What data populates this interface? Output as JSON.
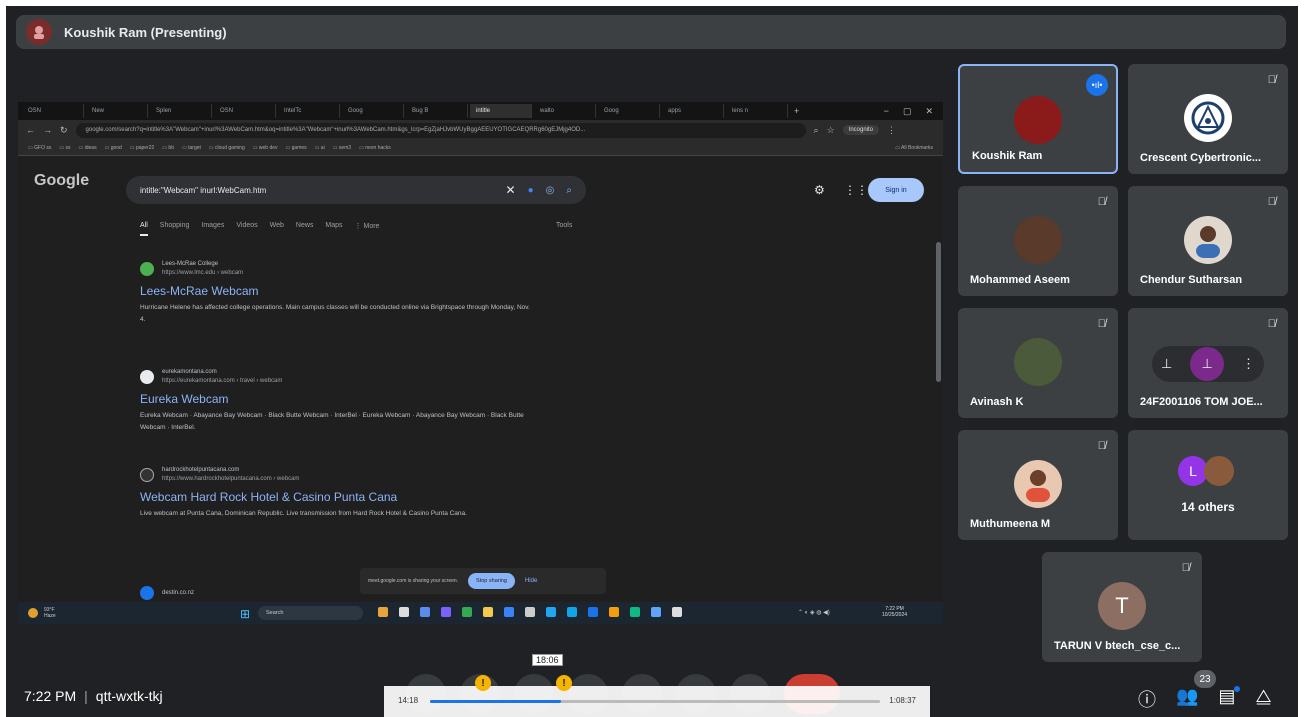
{
  "presenter": {
    "name": "Koushik Ram (Presenting)"
  },
  "meeting": {
    "time": "7:22 PM",
    "separator": "|",
    "code": "qtt-wxtk-tkj"
  },
  "browser": {
    "tabs": [
      "OSN",
      "New",
      "Splen",
      "OSN",
      "IntelTc",
      "Goog",
      "Bug B",
      "intitle",
      "walto",
      "Goog",
      "apps",
      "lens n"
    ],
    "active_tab": 7,
    "url": "google.com/search?q=intitle%3A\"Webcam\"+inurl%3AWebCam.htm&oq=intitle%3A\"Webcam\"+inurl%3AWebCam.htm&gs_lcrp=EgZjaHJvbWUyBggAEEUYOTIGCAEQRRg60gEJMjg4OD...",
    "incognito": "Incognito",
    "bookmarks": [
      "GFO ss",
      "ss",
      "ideas",
      "good",
      "paper22",
      "bb",
      "target",
      "cloud gaming",
      "web dev",
      "games",
      "ai",
      "sem3",
      "neon hacks"
    ],
    "all_bookmarks": "All Bookmarks"
  },
  "google": {
    "logo": "Google",
    "query": "intitle:\"Webcam\" inurl:WebCam.htm",
    "signin": "Sign in",
    "tabs": [
      "All",
      "Shopping",
      "Images",
      "Videos",
      "Web",
      "News",
      "Maps",
      "⋮ More"
    ],
    "tools": "Tools",
    "results": [
      {
        "site": "Lees-McRae College",
        "url": "https://www.lmc.edu › webcam",
        "title": "Lees-McRae Webcam",
        "snippet": "Hurricane Helene has affected college operations. Main campus classes will be conducted online via Brightspace through Monday, Nov. 4."
      },
      {
        "site": "eurekamontana.com",
        "url": "https://eurekamontana.com › travel › webcam",
        "title": "Eureka Webcam",
        "snippet": "Eureka Webcam · Abayance Bay Webcam · Black Butte Webcam · InterBel · Eureka Webcam · Abayance Bay Webcam · Black Butte Webcam · InterBel."
      },
      {
        "site": "hardrockhotelpuntacana.com",
        "url": "https://www.hardrockhotelpuntacana.com › webcam",
        "title": "Webcam Hard Rock Hotel & Casino Punta Cana",
        "snippet": "Live webcam at Punta Cana, Dominican Republic. Live transmission from Hard Rock Hotel & Casino Punta Cana."
      },
      {
        "site": "destin.co.nz",
        "url": "",
        "title": "",
        "snippet": ""
      }
    ],
    "share_notice": "meet.google.com is sharing your screen.",
    "stop_sharing": "Stop sharing",
    "hide": "Hide"
  },
  "taskbar": {
    "weather_temp": "93°F",
    "weather_desc": "Haze",
    "search": "Search",
    "clock_time": "7:22 PM",
    "clock_date": "10/25/2024"
  },
  "participants": [
    {
      "name": "Koushik Ram",
      "avatar_color": "#8b1a1a",
      "speaking": true,
      "muted": false
    },
    {
      "name": "Crescent Cybertronic...",
      "avatar_color": "#ffffff",
      "muted": true
    },
    {
      "name": "Mohammed Aseem",
      "avatar_color": "#5a3a2a",
      "muted": true
    },
    {
      "name": "Chendur Sutharsan",
      "avatar_color": "#e0d8cc",
      "muted": true
    },
    {
      "name": "Avinash K",
      "avatar_color": "#4a5a3a",
      "muted": true
    },
    {
      "name": "24F2001106 TOM JOE...",
      "avatar_color": "#3c4043",
      "muted": true
    },
    {
      "name": "Muthumeena M",
      "avatar_color": "#e8c8b0",
      "muted": true
    },
    {
      "name": "14 others",
      "avatar_letter": "L",
      "muted": false
    },
    {
      "name": "TARUN V btech_cse_c...",
      "avatar_letter": "T",
      "avatar_color": "#8d6e63",
      "muted": true
    }
  ],
  "people_count": "23",
  "timeline": {
    "start": "14:18",
    "end": "1:08:37",
    "tooltip": "18:06",
    "progress": 0.29
  }
}
